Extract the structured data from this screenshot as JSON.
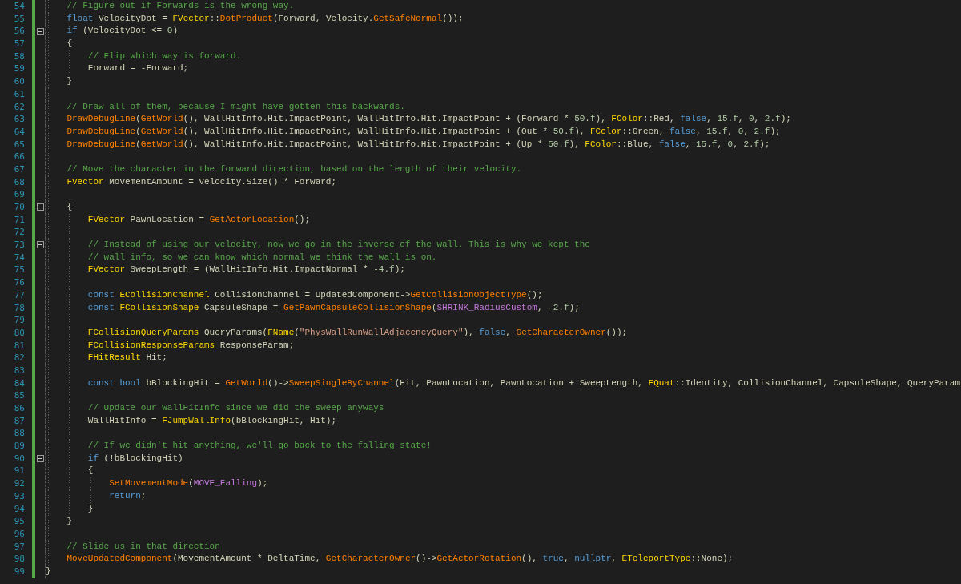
{
  "editor": {
    "lines": [
      {
        "children": [
          {
            "number": "54",
            "tokens": [
              {
                "kind": "comment",
                "text": "// Figure out if Forwards is the wrong way."
              }
            ]
          },
          {
            "number": "55",
            "tokens": [
              {
                "kind": "keyword",
                "text": "float"
              },
              {
                "kind": "plain",
                "text": " VelocityDot = "
              },
              {
                "kind": "type",
                "text": "FVector"
              },
              {
                "kind": "plain",
                "text": "::"
              },
              {
                "kind": "function",
                "text": "DotProduct"
              },
              {
                "kind": "plain",
                "text": "(Forward, Velocity."
              },
              {
                "kind": "function",
                "text": "GetSafeNormal"
              },
              {
                "kind": "plain",
                "text": "());"
              }
            ]
          },
          {
            "number": "56",
            "expanded": true,
            "tokens": [
              {
                "kind": "keyword",
                "text": "if"
              },
              {
                "kind": "plain",
                "text": " (VelocityDot <= "
              },
              {
                "kind": "number",
                "text": "0"
              },
              {
                "kind": "plain",
                "text": ")"
              }
            ]
          },
          {
            "number": "57",
            "tokens": [
              {
                "kind": "plain",
                "text": "{"
              }
            ],
            "children": [
              {
                "number": "58",
                "tokens": [
                  {
                    "kind": "comment",
                    "text": "// Flip which way is forward."
                  }
                ]
              },
              {
                "number": "59",
                "tokens": [
                  {
                    "kind": "plain",
                    "text": "Forward = -Forward;"
                  }
                ]
              }
            ]
          },
          {
            "number": "60",
            "tokens": [
              {
                "kind": "plain",
                "text": "}"
              }
            ]
          },
          {
            "number": "61"
          },
          {
            "number": "62",
            "tokens": [
              {
                "kind": "comment",
                "text": "// Draw all of them, because I might have gotten this backwards."
              }
            ]
          },
          {
            "number": "63",
            "tokens": [
              {
                "kind": "function",
                "text": "DrawDebugLine"
              },
              {
                "kind": "plain",
                "text": "("
              },
              {
                "kind": "function",
                "text": "GetWorld"
              },
              {
                "kind": "plain",
                "text": "(), WallHitInfo.Hit.ImpactPoint, WallHitInfo.Hit.ImpactPoint + (Forward * "
              },
              {
                "kind": "number",
                "text": "50.f"
              },
              {
                "kind": "plain",
                "text": "), "
              },
              {
                "kind": "type",
                "text": "FColor"
              },
              {
                "kind": "plain",
                "text": "::Red, "
              },
              {
                "kind": "keyword",
                "text": "false"
              },
              {
                "kind": "plain",
                "text": ", "
              },
              {
                "kind": "number",
                "text": "15.f"
              },
              {
                "kind": "plain",
                "text": ", "
              },
              {
                "kind": "number",
                "text": "0"
              },
              {
                "kind": "plain",
                "text": ", "
              },
              {
                "kind": "number",
                "text": "2.f"
              },
              {
                "kind": "plain",
                "text": ");"
              }
            ]
          },
          {
            "number": "64",
            "tokens": [
              {
                "kind": "function",
                "text": "DrawDebugLine"
              },
              {
                "kind": "plain",
                "text": "("
              },
              {
                "kind": "function",
                "text": "GetWorld"
              },
              {
                "kind": "plain",
                "text": "(), WallHitInfo.Hit.ImpactPoint, WallHitInfo.Hit.ImpactPoint + (Out * "
              },
              {
                "kind": "number",
                "text": "50.f"
              },
              {
                "kind": "plain",
                "text": "), "
              },
              {
                "kind": "type",
                "text": "FColor"
              },
              {
                "kind": "plain",
                "text": "::Green, "
              },
              {
                "kind": "keyword",
                "text": "false"
              },
              {
                "kind": "plain",
                "text": ", "
              },
              {
                "kind": "number",
                "text": "15.f"
              },
              {
                "kind": "plain",
                "text": ", "
              },
              {
                "kind": "number",
                "text": "0"
              },
              {
                "kind": "plain",
                "text": ", "
              },
              {
                "kind": "number",
                "text": "2.f"
              },
              {
                "kind": "plain",
                "text": ");"
              }
            ]
          },
          {
            "number": "65",
            "tokens": [
              {
                "kind": "function",
                "text": "DrawDebugLine"
              },
              {
                "kind": "plain",
                "text": "("
              },
              {
                "kind": "function",
                "text": "GetWorld"
              },
              {
                "kind": "plain",
                "text": "(), WallHitInfo.Hit.ImpactPoint, WallHitInfo.Hit.ImpactPoint + (Up * "
              },
              {
                "kind": "number",
                "text": "50.f"
              },
              {
                "kind": "plain",
                "text": "), "
              },
              {
                "kind": "type",
                "text": "FColor"
              },
              {
                "kind": "plain",
                "text": "::Blue, "
              },
              {
                "kind": "keyword",
                "text": "false"
              },
              {
                "kind": "plain",
                "text": ", "
              },
              {
                "kind": "number",
                "text": "15.f"
              },
              {
                "kind": "plain",
                "text": ", "
              },
              {
                "kind": "number",
                "text": "0"
              },
              {
                "kind": "plain",
                "text": ", "
              },
              {
                "kind": "number",
                "text": "2.f"
              },
              {
                "kind": "plain",
                "text": ");"
              }
            ]
          },
          {
            "number": "66"
          },
          {
            "number": "67",
            "tokens": [
              {
                "kind": "comment",
                "text": "// Move the character in the forward direction, based on the length of their velocity."
              }
            ]
          },
          {
            "number": "68",
            "tokens": [
              {
                "kind": "type",
                "text": "FVector"
              },
              {
                "kind": "plain",
                "text": " MovementAmount = Velocity.Size() * Forward;"
              }
            ]
          },
          {
            "number": "69"
          },
          {
            "number": "70",
            "expanded": true,
            "tokens": [
              {
                "kind": "plain",
                "text": "{"
              }
            ],
            "children": [
              {
                "number": "71",
                "tokens": [
                  {
                    "kind": "type",
                    "text": "FVector"
                  },
                  {
                    "kind": "plain",
                    "text": " PawnLocation = "
                  },
                  {
                    "kind": "function",
                    "text": "GetActorLocation"
                  },
                  {
                    "kind": "plain",
                    "text": "();"
                  }
                ]
              },
              {
                "number": "72"
              },
              {
                "number": "73",
                "expanded": true,
                "tokens": [
                  {
                    "kind": "comment",
                    "text": "// Instead of using our velocity, now we go in the inverse of the wall. This is why we kept the"
                  }
                ]
              },
              {
                "number": "74",
                "tokens": [
                  {
                    "kind": "comment",
                    "text": "// wall info, so we can know which normal we think the wall is on."
                  }
                ]
              },
              {
                "number": "75",
                "tokens": [
                  {
                    "kind": "type",
                    "text": "FVector"
                  },
                  {
                    "kind": "plain",
                    "text": " SweepLength = (WallHitInfo.Hit.ImpactNormal * "
                  },
                  {
                    "kind": "number",
                    "text": "-4.f"
                  },
                  {
                    "kind": "plain",
                    "text": ");"
                  }
                ]
              },
              {
                "number": "76"
              },
              {
                "number": "77",
                "tokens": [
                  {
                    "kind": "keyword",
                    "text": "const"
                  },
                  {
                    "kind": "type",
                    "text": " ECollisionChannel"
                  },
                  {
                    "kind": "plain",
                    "text": " CollisionChannel = UpdatedComponent->"
                  },
                  {
                    "kind": "function",
                    "text": "GetCollisionObjectType"
                  },
                  {
                    "kind": "plain",
                    "text": "();"
                  }
                ]
              },
              {
                "number": "78",
                "tokens": [
                  {
                    "kind": "keyword",
                    "text": "const"
                  },
                  {
                    "kind": "type",
                    "text": " FCollisionShape"
                  },
                  {
                    "kind": "plain",
                    "text": " CapsuleShape = "
                  },
                  {
                    "kind": "function",
                    "text": "GetPawnCapsuleCollisionShape"
                  },
                  {
                    "kind": "plain",
                    "text": "("
                  },
                  {
                    "kind": "macro",
                    "text": "SHRINK_RadiusCustom"
                  },
                  {
                    "kind": "plain",
                    "text": ", "
                  },
                  {
                    "kind": "number",
                    "text": "-2.f"
                  },
                  {
                    "kind": "plain",
                    "text": ");"
                  }
                ]
              },
              {
                "number": "79"
              },
              {
                "number": "80",
                "tokens": [
                  {
                    "kind": "type",
                    "text": "FCollisionQueryParams"
                  },
                  {
                    "kind": "plain",
                    "text": " QueryParams("
                  },
                  {
                    "kind": "type",
                    "text": "FName"
                  },
                  {
                    "kind": "plain",
                    "text": "("
                  },
                  {
                    "kind": "string",
                    "text": "\"PhysWallRunWallAdjacencyQuery\""
                  },
                  {
                    "kind": "plain",
                    "text": "), "
                  },
                  {
                    "kind": "keyword",
                    "text": "false"
                  },
                  {
                    "kind": "plain",
                    "text": ", "
                  },
                  {
                    "kind": "function",
                    "text": "GetCharacterOwner"
                  },
                  {
                    "kind": "plain",
                    "text": "());"
                  }
                ]
              },
              {
                "number": "81",
                "tokens": [
                  {
                    "kind": "type",
                    "text": "FCollisionResponseParams"
                  },
                  {
                    "kind": "plain",
                    "text": " ResponseParam;"
                  }
                ]
              },
              {
                "number": "82",
                "tokens": [
                  {
                    "kind": "type",
                    "text": "FHitResult"
                  },
                  {
                    "kind": "plain",
                    "text": " Hit;"
                  }
                ]
              },
              {
                "number": "83"
              },
              {
                "number": "84",
                "tokens": [
                  {
                    "kind": "keyword",
                    "text": "const bool"
                  },
                  {
                    "kind": "plain",
                    "text": " bBlockingHit = "
                  },
                  {
                    "kind": "function",
                    "text": "GetWorld"
                  },
                  {
                    "kind": "plain",
                    "text": "()->"
                  },
                  {
                    "kind": "function",
                    "text": "SweepSingleByChannel"
                  },
                  {
                    "kind": "plain",
                    "text": "(Hit, PawnLocation, PawnLocation + SweepLength, "
                  },
                  {
                    "kind": "type",
                    "text": "FQuat"
                  },
                  {
                    "kind": "plain",
                    "text": "::Identity, CollisionChannel, CapsuleShape, QueryParam"
                  }
                ]
              },
              {
                "number": "85"
              },
              {
                "number": "86",
                "tokens": [
                  {
                    "kind": "comment",
                    "text": "// Update our WallHitInfo since we did the sweep anyways"
                  }
                ]
              },
              {
                "number": "87",
                "tokens": [
                  {
                    "kind": "plain",
                    "text": "WallHitInfo = "
                  },
                  {
                    "kind": "type",
                    "text": "FJumpWallInfo"
                  },
                  {
                    "kind": "plain",
                    "text": "(bBlockingHit, Hit);"
                  }
                ]
              },
              {
                "number": "88"
              },
              {
                "number": "89",
                "tokens": [
                  {
                    "kind": "comment",
                    "text": "// If we didn't hit anything, we'll go back to the falling state!"
                  }
                ]
              },
              {
                "number": "90",
                "expanded": true,
                "tokens": [
                  {
                    "kind": "keyword",
                    "text": "if"
                  },
                  {
                    "kind": "plain",
                    "text": " (!bBlockingHit)"
                  }
                ]
              },
              {
                "number": "91",
                "tokens": [
                  {
                    "kind": "plain",
                    "text": "{"
                  }
                ],
                "children": [
                  {
                    "number": "92",
                    "tokens": [
                      {
                        "kind": "function",
                        "text": "SetMovementMode"
                      },
                      {
                        "kind": "plain",
                        "text": "("
                      },
                      {
                        "kind": "macro",
                        "text": "MOVE_Falling"
                      },
                      {
                        "kind": "plain",
                        "text": ");"
                      }
                    ]
                  },
                  {
                    "number": "93",
                    "tokens": [
                      {
                        "kind": "keyword",
                        "text": "return"
                      },
                      {
                        "kind": "plain",
                        "text": ";"
                      }
                    ]
                  }
                ]
              },
              {
                "number": "94",
                "tokens": [
                  {
                    "kind": "plain",
                    "text": "}"
                  }
                ]
              }
            ]
          },
          {
            "number": "95",
            "tokens": [
              {
                "kind": "plain",
                "text": "}"
              }
            ]
          },
          {
            "number": "96"
          },
          {
            "number": "97",
            "tokens": [
              {
                "kind": "comment",
                "text": "// Slide us in that direction"
              }
            ]
          },
          {
            "number": "98",
            "tokens": [
              {
                "kind": "function",
                "text": "MoveUpdatedComponent"
              },
              {
                "kind": "plain",
                "text": "(MovementAmount * DeltaTime, "
              },
              {
                "kind": "function",
                "text": "GetCharacterOwner"
              },
              {
                "kind": "plain",
                "text": "()->"
              },
              {
                "kind": "function",
                "text": "GetActorRotation"
              },
              {
                "kind": "plain",
                "text": "(), "
              },
              {
                "kind": "keyword",
                "text": "true"
              },
              {
                "kind": "plain",
                "text": ", "
              },
              {
                "kind": "keyword",
                "text": "nullptr"
              },
              {
                "kind": "plain",
                "text": ", "
              },
              {
                "kind": "type",
                "text": "ETeleportType"
              },
              {
                "kind": "plain",
                "text": "::None);"
              }
            ]
          }
        ]
      },
      {
        "number": "99",
        "tokens": [
          {
            "kind": "plain",
            "text": "}"
          }
        ]
      }
    ]
  }
}
